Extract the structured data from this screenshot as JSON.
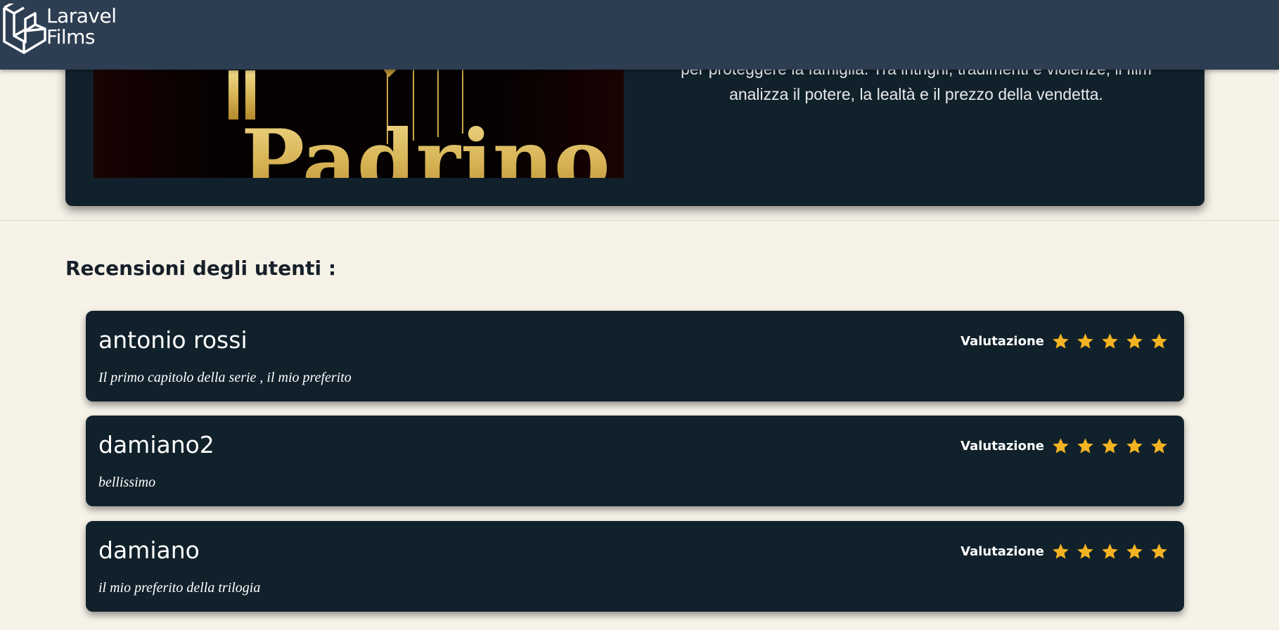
{
  "brand": {
    "line1": "Laravel",
    "line2": "Films",
    "logo_icon": "laravel-cube-icon"
  },
  "movie": {
    "poster_text": "Il Padrino",
    "synopsis_line1": "per proteggere la famiglia. Tra intrighi, tradimenti e violenze, il film",
    "synopsis_line2": "analizza il potere, la lealtà e il prezzo della vendetta."
  },
  "reviews": {
    "title": "Recensioni degli utenti :",
    "rating_label": "Valutazione",
    "star_color": "#f4b322",
    "items": [
      {
        "author": "antonio rossi",
        "comment": "Il primo capitolo della serie , il mio preferito",
        "rating": 5
      },
      {
        "author": "damiano2",
        "comment": "bellissimo",
        "rating": 5
      },
      {
        "author": "damiano",
        "comment": "il mio preferito della trilogia",
        "rating": 5
      }
    ]
  },
  "colors": {
    "navbar": "#2d3e53",
    "background": "#f6f2e8",
    "card": "#11212b"
  }
}
